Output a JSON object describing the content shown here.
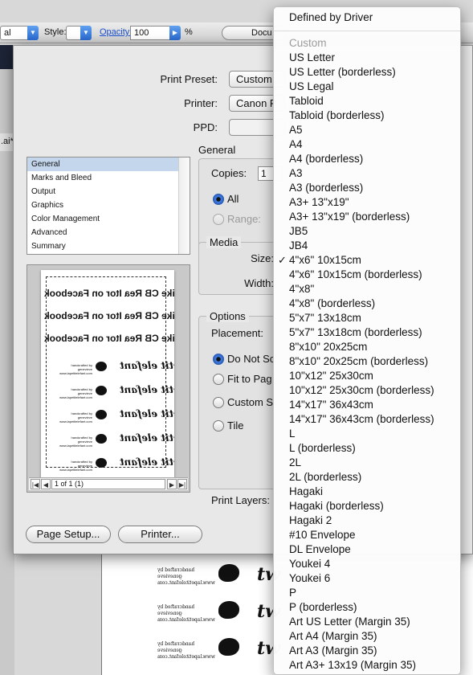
{
  "toolbar": {
    "left_select_value": "al",
    "style_label": "Style:",
    "opacity_label": "Opacity:",
    "opacity_value": "100",
    "percent": "%",
    "document_button": "Docu"
  },
  "background": {
    "tab_label": ".ai*",
    "doc_rows": [
      {
        "small_text": "handcrafted by genevieve\nwww.lapetitelefant.com",
        "word": "tw"
      },
      {
        "small_text": "handcrafted by genevieve\nwww.lapetitelefant.com",
        "word": "tw"
      },
      {
        "small_text": "handcrafted by genevieve\nwww.lapetitelefant.com",
        "word": "tw"
      }
    ]
  },
  "dialog": {
    "print_preset_label": "Print Preset:",
    "print_preset_value": "Custom",
    "printer_label": "Printer:",
    "printer_value": "Canon P",
    "ppd_label": "PPD:",
    "categories": [
      "General",
      "Marks and Bleed",
      "Output",
      "Graphics",
      "Color Management",
      "Advanced",
      "Summary"
    ],
    "selected_category": "General",
    "preview": {
      "banner_text": "Like CB Rea Itor on Facebook",
      "row_small_text": "handcrafted by genevieve www.lapetitelefant.com",
      "row_word": "lapetit elefant",
      "page_counter": "1 of 1 (1)"
    },
    "general_title": "General",
    "copies_label": "Copies:",
    "copies_value": "1",
    "range_all_label": "All",
    "range_range_label": "Range:",
    "media_title": "Media",
    "size_label": "Size:",
    "width_label": "Width:",
    "options_title": "Options",
    "placement_label": "Placement:",
    "scaling_options": [
      "Do Not Sc",
      "Fit to Pag",
      "Custom S",
      "Tile"
    ],
    "print_layers_label": "Print Layers:",
    "page_setup_button": "Page Setup...",
    "printer_button": "Printer..."
  },
  "menu": {
    "header": "Defined by Driver",
    "items": [
      {
        "label": "Custom",
        "disabled": true,
        "checked": false
      },
      {
        "label": "US Letter",
        "disabled": false,
        "checked": false
      },
      {
        "label": "US Letter (borderless)",
        "disabled": false,
        "checked": false
      },
      {
        "label": "US Legal",
        "disabled": false,
        "checked": false
      },
      {
        "label": "Tabloid",
        "disabled": false,
        "checked": false
      },
      {
        "label": "Tabloid (borderless)",
        "disabled": false,
        "checked": false
      },
      {
        "label": "A5",
        "disabled": false,
        "checked": false
      },
      {
        "label": "A4",
        "disabled": false,
        "checked": false
      },
      {
        "label": "A4 (borderless)",
        "disabled": false,
        "checked": false
      },
      {
        "label": "A3",
        "disabled": false,
        "checked": false
      },
      {
        "label": "A3 (borderless)",
        "disabled": false,
        "checked": false
      },
      {
        "label": "A3+ 13\"x19\"",
        "disabled": false,
        "checked": false
      },
      {
        "label": "A3+ 13\"x19\" (borderless)",
        "disabled": false,
        "checked": false
      },
      {
        "label": "JB5",
        "disabled": false,
        "checked": false
      },
      {
        "label": "JB4",
        "disabled": false,
        "checked": false
      },
      {
        "label": "4\"x6\" 10x15cm",
        "disabled": false,
        "checked": true
      },
      {
        "label": "4\"x6\" 10x15cm (borderless)",
        "disabled": false,
        "checked": false
      },
      {
        "label": "4\"x8\"",
        "disabled": false,
        "checked": false
      },
      {
        "label": "4\"x8\" (borderless)",
        "disabled": false,
        "checked": false
      },
      {
        "label": "5\"x7\" 13x18cm",
        "disabled": false,
        "checked": false
      },
      {
        "label": "5\"x7\" 13x18cm (borderless)",
        "disabled": false,
        "checked": false
      },
      {
        "label": "8\"x10\" 20x25cm",
        "disabled": false,
        "checked": false
      },
      {
        "label": "8\"x10\" 20x25cm (borderless)",
        "disabled": false,
        "checked": false
      },
      {
        "label": "10\"x12\" 25x30cm",
        "disabled": false,
        "checked": false
      },
      {
        "label": "10\"x12\" 25x30cm (borderless)",
        "disabled": false,
        "checked": false
      },
      {
        "label": "14\"x17\" 36x43cm",
        "disabled": false,
        "checked": false
      },
      {
        "label": "14\"x17\" 36x43cm (borderless)",
        "disabled": false,
        "checked": false
      },
      {
        "label": "L",
        "disabled": false,
        "checked": false
      },
      {
        "label": "L (borderless)",
        "disabled": false,
        "checked": false
      },
      {
        "label": "2L",
        "disabled": false,
        "checked": false
      },
      {
        "label": "2L (borderless)",
        "disabled": false,
        "checked": false
      },
      {
        "label": "Hagaki",
        "disabled": false,
        "checked": false
      },
      {
        "label": "Hagaki (borderless)",
        "disabled": false,
        "checked": false
      },
      {
        "label": "Hagaki 2",
        "disabled": false,
        "checked": false
      },
      {
        "label": "#10 Envelope",
        "disabled": false,
        "checked": false
      },
      {
        "label": "DL Envelope",
        "disabled": false,
        "checked": false
      },
      {
        "label": "Youkei 4",
        "disabled": false,
        "checked": false
      },
      {
        "label": "Youkei 6",
        "disabled": false,
        "checked": false
      },
      {
        "label": "P",
        "disabled": false,
        "checked": false
      },
      {
        "label": "P (borderless)",
        "disabled": false,
        "checked": false
      },
      {
        "label": "Art US Letter (Margin 35)",
        "disabled": false,
        "checked": false
      },
      {
        "label": "Art A4 (Margin 35)",
        "disabled": false,
        "checked": false
      },
      {
        "label": "Art A3 (Margin 35)",
        "disabled": false,
        "checked": false
      },
      {
        "label": "Art A3+ 13x19 (Margin 35)",
        "disabled": false,
        "checked": false
      }
    ],
    "check_glyph": "✓"
  },
  "colors": {
    "accent_blue": "#2a6ad0",
    "selection": "#c4d6ec",
    "disabled_text": "#9b9b9b"
  }
}
